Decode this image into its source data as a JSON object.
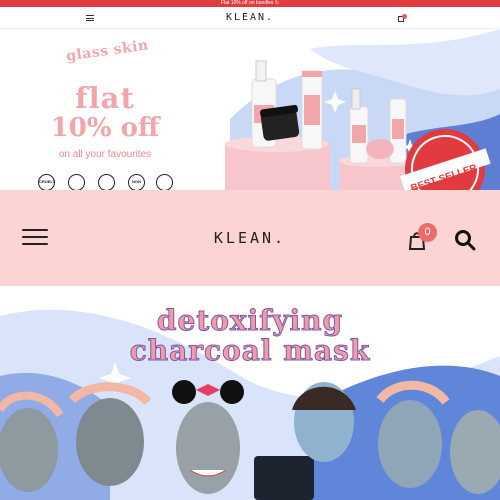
{
  "announcement": "Flat 10% off on bundles ↻",
  "mini_header": {
    "logo": "KLEAN."
  },
  "hero": {
    "tag": "glass skin",
    "headline_line1": "flat",
    "headline_line2": "10% off",
    "subtitle": "on all your favourites",
    "badge_seller": "BEST SELLER",
    "badges": [
      "CRUELTY FREE",
      "",
      "",
      "NON",
      ""
    ]
  },
  "header": {
    "logo": "KLEAN.",
    "cart_count": "0"
  },
  "promo": {
    "title_line1": "detoxifying",
    "title_line2": "charcoal mask"
  },
  "colors": {
    "accent_pink": "#f2a6ab",
    "header_bg": "#fcd4d4",
    "badge_red": "#ef6b6b",
    "announce_bg": "#e23b3f"
  },
  "icons": {
    "menu": "hamburger-icon",
    "cart": "shopping-bag-icon",
    "search": "search-icon"
  }
}
